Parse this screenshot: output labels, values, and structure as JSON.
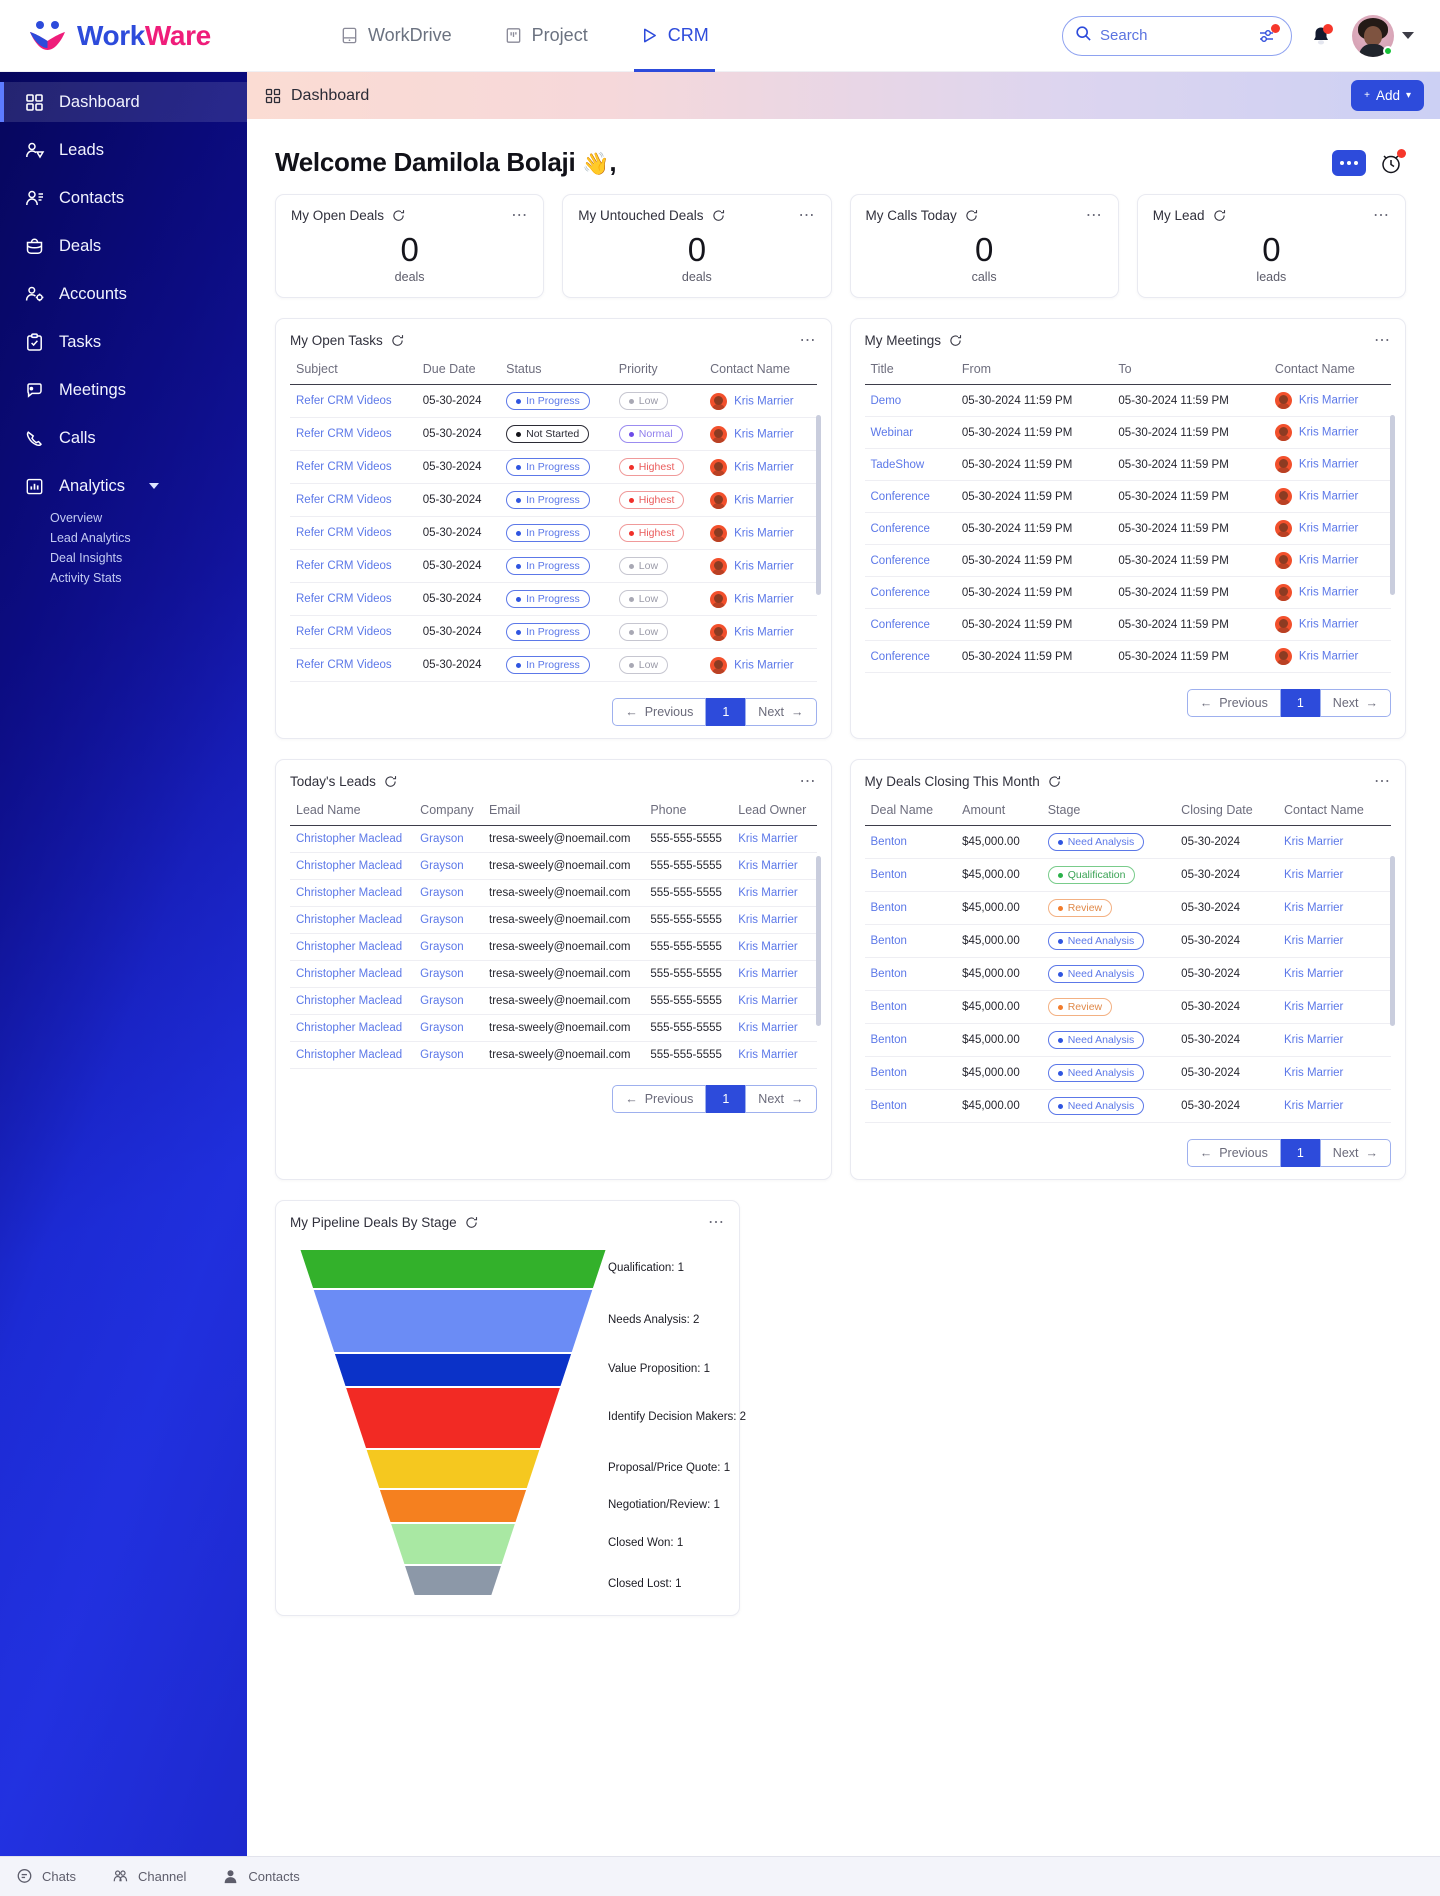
{
  "brand": {
    "part1": "Work",
    "part2": "Ware"
  },
  "appnav": [
    {
      "label": "WorkDrive",
      "icon": "drive-icon",
      "active": false
    },
    {
      "label": "Project",
      "icon": "project-icon",
      "active": false
    },
    {
      "label": "CRM",
      "icon": "crm-icon",
      "active": true
    }
  ],
  "search": {
    "placeholder": "Search",
    "value": ""
  },
  "sidebar": {
    "items": [
      {
        "label": "Dashboard",
        "icon": "grid-icon",
        "active": true
      },
      {
        "label": "Leads",
        "icon": "leads-icon",
        "active": false
      },
      {
        "label": "Contacts",
        "icon": "contacts-icon",
        "active": false
      },
      {
        "label": "Deals",
        "icon": "deals-icon",
        "active": false
      },
      {
        "label": "Accounts",
        "icon": "accounts-icon",
        "active": false
      },
      {
        "label": "Tasks",
        "icon": "tasks-icon",
        "active": false
      },
      {
        "label": "Meetings",
        "icon": "meetings-icon",
        "active": false
      },
      {
        "label": "Calls",
        "icon": "calls-icon",
        "active": false
      },
      {
        "label": "Analytics",
        "icon": "analytics-icon",
        "active": false,
        "expanded": true
      }
    ],
    "analytics_sub": [
      "Overview",
      "Lead Analytics",
      "Deal Insights",
      "Activity Stats"
    ]
  },
  "breadcrumb": {
    "label": "Dashboard"
  },
  "add_button": {
    "label": "Add",
    "plus": "+",
    "caret": "▾"
  },
  "welcome": {
    "title": "Welcome Damilola Bolaji",
    "wave": "👋",
    "comma": ","
  },
  "kpis": [
    {
      "title": "My Open Deals",
      "value": "0",
      "unit": "deals"
    },
    {
      "title": "My Untouched Deals",
      "value": "0",
      "unit": "deals"
    },
    {
      "title": "My Calls Today",
      "value": "0",
      "unit": "calls"
    },
    {
      "title": "My Lead",
      "value": "0",
      "unit": "leads"
    }
  ],
  "open_tasks": {
    "title": "My Open Tasks",
    "columns": [
      "Subject",
      "Due Date",
      "Status",
      "Priority",
      "Contact Name"
    ],
    "rows": [
      {
        "subject": "Refer CRM Videos",
        "due": "05-30-2024",
        "status": "In Progress",
        "status_style": "p-blue",
        "priority": "Low",
        "priority_style": "p-grey",
        "contact": "Kris Marrier"
      },
      {
        "subject": "Refer CRM Videos",
        "due": "05-30-2024",
        "status": "Not Started",
        "status_style": "p-dark",
        "priority": "Normal",
        "priority_style": "p-purple",
        "contact": "Kris Marrier"
      },
      {
        "subject": "Refer CRM Videos",
        "due": "05-30-2024",
        "status": "In Progress",
        "status_style": "p-blue",
        "priority": "Highest",
        "priority_style": "p-red",
        "contact": "Kris Marrier"
      },
      {
        "subject": "Refer CRM Videos",
        "due": "05-30-2024",
        "status": "In Progress",
        "status_style": "p-blue",
        "priority": "Highest",
        "priority_style": "p-red",
        "contact": "Kris Marrier"
      },
      {
        "subject": "Refer CRM Videos",
        "due": "05-30-2024",
        "status": "In Progress",
        "status_style": "p-blue",
        "priority": "Highest",
        "priority_style": "p-red",
        "contact": "Kris Marrier"
      },
      {
        "subject": "Refer CRM Videos",
        "due": "05-30-2024",
        "status": "In Progress",
        "status_style": "p-blue",
        "priority": "Low",
        "priority_style": "p-grey",
        "contact": "Kris Marrier"
      },
      {
        "subject": "Refer CRM Videos",
        "due": "05-30-2024",
        "status": "In Progress",
        "status_style": "p-blue",
        "priority": "Low",
        "priority_style": "p-grey",
        "contact": "Kris Marrier"
      },
      {
        "subject": "Refer CRM Videos",
        "due": "05-30-2024",
        "status": "In Progress",
        "status_style": "p-blue",
        "priority": "Low",
        "priority_style": "p-grey",
        "contact": "Kris Marrier"
      },
      {
        "subject": "Refer CRM Videos",
        "due": "05-30-2024",
        "status": "In Progress",
        "status_style": "p-blue",
        "priority": "Low",
        "priority_style": "p-grey",
        "contact": "Kris Marrier"
      }
    ]
  },
  "meetings": {
    "title": "My Meetings",
    "columns": [
      "Title",
      "From",
      "To",
      "Contact Name"
    ],
    "rows": [
      {
        "title": "Demo",
        "from": "05-30-2024 11:59 PM",
        "to": "05-30-2024 11:59 PM",
        "contact": "Kris Marrier"
      },
      {
        "title": "Webinar",
        "from": "05-30-2024 11:59 PM",
        "to": "05-30-2024 11:59 PM",
        "contact": "Kris Marrier"
      },
      {
        "title": "TadeShow",
        "from": "05-30-2024 11:59 PM",
        "to": "05-30-2024 11:59 PM",
        "contact": "Kris Marrier"
      },
      {
        "title": "Conference",
        "from": "05-30-2024 11:59 PM",
        "to": "05-30-2024 11:59 PM",
        "contact": "Kris Marrier"
      },
      {
        "title": "Conference",
        "from": "05-30-2024 11:59 PM",
        "to": "05-30-2024 11:59 PM",
        "contact": "Kris Marrier"
      },
      {
        "title": "Conference",
        "from": "05-30-2024 11:59 PM",
        "to": "05-30-2024 11:59 PM",
        "contact": "Kris Marrier"
      },
      {
        "title": "Conference",
        "from": "05-30-2024 11:59 PM",
        "to": "05-30-2024 11:59 PM",
        "contact": "Kris Marrier"
      },
      {
        "title": "Conference",
        "from": "05-30-2024 11:59 PM",
        "to": "05-30-2024 11:59 PM",
        "contact": "Kris Marrier"
      },
      {
        "title": "Conference",
        "from": "05-30-2024 11:59 PM",
        "to": "05-30-2024 11:59 PM",
        "contact": "Kris Marrier"
      }
    ]
  },
  "todays_leads": {
    "title": "Today's Leads",
    "columns": [
      "Lead Name",
      "Company",
      "Email",
      "Phone",
      "Lead Owner"
    ],
    "rows": [
      {
        "name": "Christopher Maclead",
        "company": "Grayson",
        "email": "tresa-sweely@noemail.com",
        "phone": "555-555-5555",
        "owner": "Kris Marrier"
      },
      {
        "name": "Christopher Maclead",
        "company": "Grayson",
        "email": "tresa-sweely@noemail.com",
        "phone": "555-555-5555",
        "owner": "Kris Marrier"
      },
      {
        "name": "Christopher Maclead",
        "company": "Grayson",
        "email": "tresa-sweely@noemail.com",
        "phone": "555-555-5555",
        "owner": "Kris Marrier"
      },
      {
        "name": "Christopher Maclead",
        "company": "Grayson",
        "email": "tresa-sweely@noemail.com",
        "phone": "555-555-5555",
        "owner": "Kris Marrier"
      },
      {
        "name": "Christopher Maclead",
        "company": "Grayson",
        "email": "tresa-sweely@noemail.com",
        "phone": "555-555-5555",
        "owner": "Kris Marrier"
      },
      {
        "name": "Christopher Maclead",
        "company": "Grayson",
        "email": "tresa-sweely@noemail.com",
        "phone": "555-555-5555",
        "owner": "Kris Marrier"
      },
      {
        "name": "Christopher Maclead",
        "company": "Grayson",
        "email": "tresa-sweely@noemail.com",
        "phone": "555-555-5555",
        "owner": "Kris Marrier"
      },
      {
        "name": "Christopher Maclead",
        "company": "Grayson",
        "email": "tresa-sweely@noemail.com",
        "phone": "555-555-5555",
        "owner": "Kris Marrier"
      },
      {
        "name": "Christopher Maclead",
        "company": "Grayson",
        "email": "tresa-sweely@noemail.com",
        "phone": "555-555-5555",
        "owner": "Kris Marrier"
      }
    ]
  },
  "deals_closing": {
    "title": "My Deals Closing This Month",
    "columns": [
      "Deal Name",
      "Amount",
      "Stage",
      "Closing Date",
      "Contact Name"
    ],
    "rows": [
      {
        "deal": "Benton",
        "amount": "$45,000.00",
        "stage": "Need Analysis",
        "stage_style": "p-blue",
        "closing": "05-30-2024",
        "contact": "Kris Marrier"
      },
      {
        "deal": "Benton",
        "amount": "$45,000.00",
        "stage": "Qualification",
        "stage_style": "p-green",
        "closing": "05-30-2024",
        "contact": "Kris Marrier"
      },
      {
        "deal": "Benton",
        "amount": "$45,000.00",
        "stage": "Review",
        "stage_style": "p-orange",
        "closing": "05-30-2024",
        "contact": "Kris Marrier"
      },
      {
        "deal": "Benton",
        "amount": "$45,000.00",
        "stage": "Need Analysis",
        "stage_style": "p-blue",
        "closing": "05-30-2024",
        "contact": "Kris Marrier"
      },
      {
        "deal": "Benton",
        "amount": "$45,000.00",
        "stage": "Need Analysis",
        "stage_style": "p-blue",
        "closing": "05-30-2024",
        "contact": "Kris Marrier"
      },
      {
        "deal": "Benton",
        "amount": "$45,000.00",
        "stage": "Review",
        "stage_style": "p-orange",
        "closing": "05-30-2024",
        "contact": "Kris Marrier"
      },
      {
        "deal": "Benton",
        "amount": "$45,000.00",
        "stage": "Need Analysis",
        "stage_style": "p-blue",
        "closing": "05-30-2024",
        "contact": "Kris Marrier"
      },
      {
        "deal": "Benton",
        "amount": "$45,000.00",
        "stage": "Need Analysis",
        "stage_style": "p-blue",
        "closing": "05-30-2024",
        "contact": "Kris Marrier"
      },
      {
        "deal": "Benton",
        "amount": "$45,000.00",
        "stage": "Need Analysis",
        "stage_style": "p-blue",
        "closing": "05-30-2024",
        "contact": "Kris Marrier"
      }
    ]
  },
  "pagination": {
    "previous": "Previous",
    "page": "1",
    "next": "Next",
    "prev_arrow": "←",
    "next_arrow": "→"
  },
  "pipeline": {
    "title": "My Pipeline Deals By Stage"
  },
  "chart_data": {
    "type": "funnel",
    "title": "My Pipeline Deals By Stage",
    "categories": [
      "Qualification",
      "Needs Analysis",
      "Value Proposition",
      "Identify Decision Makers",
      "Proposal/Price Quote",
      "Negotiation/Review",
      "Closed Won",
      "Closed Lost"
    ],
    "values": [
      1,
      2,
      1,
      2,
      1,
      1,
      1,
      1
    ],
    "labels": [
      "Qualification: 1",
      "Needs Analysis: 2",
      "Value Proposition: 1",
      "Identify Decision Makers: 2",
      "Proposal/Price Quote: 1",
      "Negotiation/Review: 1",
      "Closed Won: 1",
      "Closed Lost: 1"
    ],
    "colors": [
      "#33b12b",
      "#6b8cf5",
      "#0b32c8",
      "#f22a24",
      "#f5c81f",
      "#f5801f",
      "#a9e8a3",
      "#8c98a8"
    ],
    "legend": "right",
    "grid": false
  },
  "bottombar": [
    {
      "label": "Chats",
      "icon": "chat-icon"
    },
    {
      "label": "Channel",
      "icon": "channel-icon"
    },
    {
      "label": "Contacts",
      "icon": "contacts-icon"
    }
  ]
}
